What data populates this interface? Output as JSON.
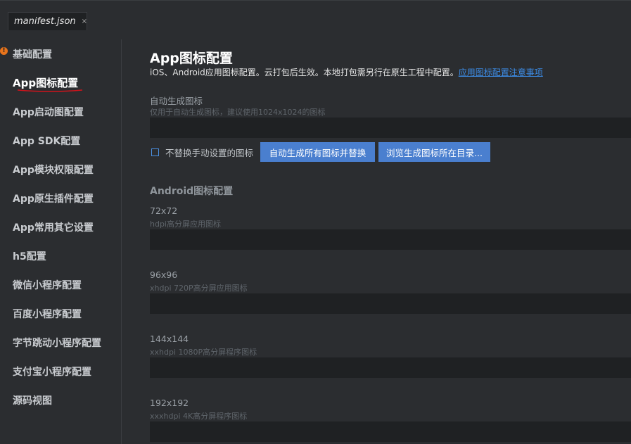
{
  "tab": {
    "title": "manifest.json",
    "close": "×"
  },
  "sidebar": {
    "items": [
      {
        "label": "基础配置",
        "warning": "!"
      },
      {
        "label": "App图标配置"
      },
      {
        "label": "App启动图配置"
      },
      {
        "label": "App SDK配置"
      },
      {
        "label": "App模块权限配置"
      },
      {
        "label": "App原生插件配置"
      },
      {
        "label": "App常用其它设置"
      },
      {
        "label": "h5配置"
      },
      {
        "label": "微信小程序配置"
      },
      {
        "label": "百度小程序配置"
      },
      {
        "label": "字节跳动小程序配置"
      },
      {
        "label": "支付宝小程序配置"
      },
      {
        "label": "源码视图"
      }
    ],
    "active_index": 1
  },
  "main": {
    "title": "App图标配置",
    "description": "iOS、Android应用图标配置。云打包后生效。本地打包需另行在原生工程中配置。",
    "doc_link": "应用图标配置注意事项",
    "auto_gen": {
      "label": "自动生成图标",
      "hint": "仅用于自动生成图标，建议使用1024x1024的图标",
      "value": ""
    },
    "checkbox_label": "不替换手动设置的图标",
    "checkbox_checked": false,
    "btn_generate": "自动生成所有图标并替换",
    "btn_browse": "浏览生成图标所在目录...",
    "android_section": "Android图标配置",
    "icons": [
      {
        "label": "72x72",
        "hint": "hdpi高分屏应用图标",
        "value": ""
      },
      {
        "label": "96x96",
        "hint": "xhdpi 720P高分屏应用图标",
        "value": ""
      },
      {
        "label": "144x144",
        "hint": "xxhdpi 1080P高分屏程序图标",
        "value": ""
      },
      {
        "label": "192x192",
        "hint": "xxxhdpi 4K高分屏程序图标",
        "value": ""
      }
    ]
  },
  "colors": {
    "background": "#2b2d30",
    "input": "#1f2123",
    "button": "#4a7fcf",
    "link": "#3c8ce6",
    "warning": "#e8741c",
    "active_underline": "#d0131b"
  }
}
